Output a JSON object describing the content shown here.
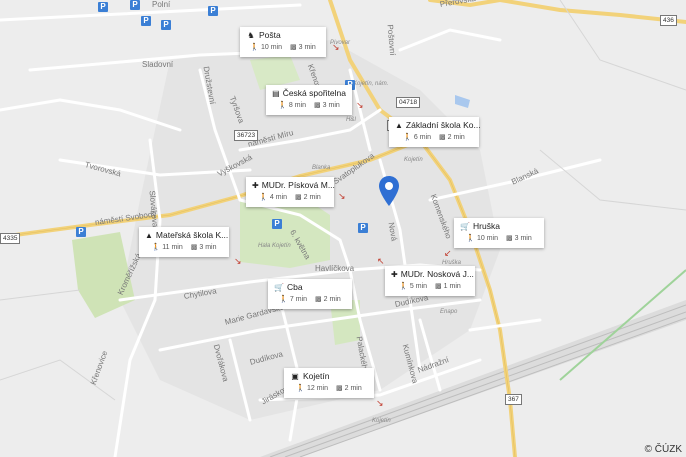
{
  "map": {
    "copyright": "© ČÚZK",
    "accent": "#2f6fd3",
    "streets": [
      {
        "id": "polni",
        "text": "Polní"
      },
      {
        "id": "sladovni",
        "text": "Sladovní"
      },
      {
        "id": "druzstevni",
        "text": "Družstevní"
      },
      {
        "id": "tyrsova",
        "text": "Tyršova"
      },
      {
        "id": "nam-mir",
        "text": "náměstí Míru"
      },
      {
        "id": "vyskovska",
        "text": "Vyškovská"
      },
      {
        "id": "tvorovska",
        "text": "Tvorovská"
      },
      {
        "id": "slovakova",
        "text": "Slovákova"
      },
      {
        "id": "nam-svobody",
        "text": "náměstí Svobody"
      },
      {
        "id": "kremisirska",
        "text": "Kroměřížská"
      },
      {
        "id": "svatoplukova",
        "text": "Svatoplukova"
      },
      {
        "id": "blanska",
        "text": "Blanská"
      },
      {
        "id": "nova",
        "text": "Nová"
      },
      {
        "id": "komenskeho",
        "text": "Komenského"
      },
      {
        "id": "6-kvetna",
        "text": "6. května"
      },
      {
        "id": "havlickova",
        "text": "Havlíčkova"
      },
      {
        "id": "chytilova",
        "text": "Chytilova"
      },
      {
        "id": "marie-gardavske",
        "text": "Marie Gardavské"
      },
      {
        "id": "dvorakova",
        "text": "Dvořákova"
      },
      {
        "id": "dudikova1",
        "text": "Dudíkova"
      },
      {
        "id": "dudikova2",
        "text": "Dudíkova"
      },
      {
        "id": "nadrazni",
        "text": "Nádražní"
      },
      {
        "id": "kuminkova",
        "text": "Kumínkova"
      },
      {
        "id": "palackeho",
        "text": "Palackého"
      },
      {
        "id": "jiraskova",
        "text": "Jiráskova"
      },
      {
        "id": "krenovice",
        "text": "Křenovice"
      },
      {
        "id": "prerovska",
        "text": "Přerovská"
      },
      {
        "id": "postovni",
        "text": "Poštovní"
      },
      {
        "id": "krenovicka",
        "text": "Křenovická"
      }
    ],
    "poi_labels": [
      {
        "id": "kojetin-nam",
        "text": "Kojetín, nám."
      },
      {
        "id": "kojetin-1",
        "text": "Kojetín"
      },
      {
        "id": "kojetin-2",
        "text": "Kojetín"
      },
      {
        "id": "blanka",
        "text": "Blanka"
      },
      {
        "id": "hala-kojetin",
        "text": "Hala Kojetín"
      },
      {
        "id": "hruska-small",
        "text": "Hruška"
      },
      {
        "id": "enapo",
        "text": "Enapo"
      },
      {
        "id": "hl",
        "text": "H&I"
      },
      {
        "id": "pivovar",
        "text": "Pivovar"
      }
    ],
    "road_numbers": [
      {
        "id": "r436",
        "text": "436"
      },
      {
        "id": "r04718",
        "text": "04718"
      },
      {
        "id": "r36723",
        "text": "36723"
      },
      {
        "id": "r367a",
        "text": "367"
      },
      {
        "id": "r4335",
        "text": "4335"
      },
      {
        "id": "r367b",
        "text": "367"
      }
    ]
  },
  "places": [
    {
      "id": "posta",
      "icon": "post-icon",
      "title": "Pošta",
      "walk": "10 min",
      "drive": "3 min"
    },
    {
      "id": "sporitelna",
      "icon": "bank-icon",
      "title": "Česká spořitelna",
      "walk": "8 min",
      "drive": "3 min"
    },
    {
      "id": "zakladni",
      "icon": "school-icon",
      "title": "Základní škola Ko...",
      "walk": "6 min",
      "drive": "2 min"
    },
    {
      "id": "piskova",
      "icon": "medical-icon",
      "title": "MUDr. Písková M...",
      "walk": "4 min",
      "drive": "2 min"
    },
    {
      "id": "hruska",
      "icon": "cart-icon",
      "title": "Hruška",
      "walk": "10 min",
      "drive": "3 min"
    },
    {
      "id": "materska",
      "icon": "school-icon",
      "title": "Mateřská škola K...",
      "walk": "11 min",
      "drive": "3 min"
    },
    {
      "id": "noskova",
      "icon": "medical-icon",
      "title": "MUDr. Nosková J...",
      "walk": "5 min",
      "drive": "1 min"
    },
    {
      "id": "cba",
      "icon": "cart-icon",
      "title": "Cba",
      "walk": "7 min",
      "drive": "2 min"
    },
    {
      "id": "kojetin",
      "icon": "bus-icon",
      "title": "Kojetín",
      "walk": "12 min",
      "drive": "2 min"
    }
  ]
}
